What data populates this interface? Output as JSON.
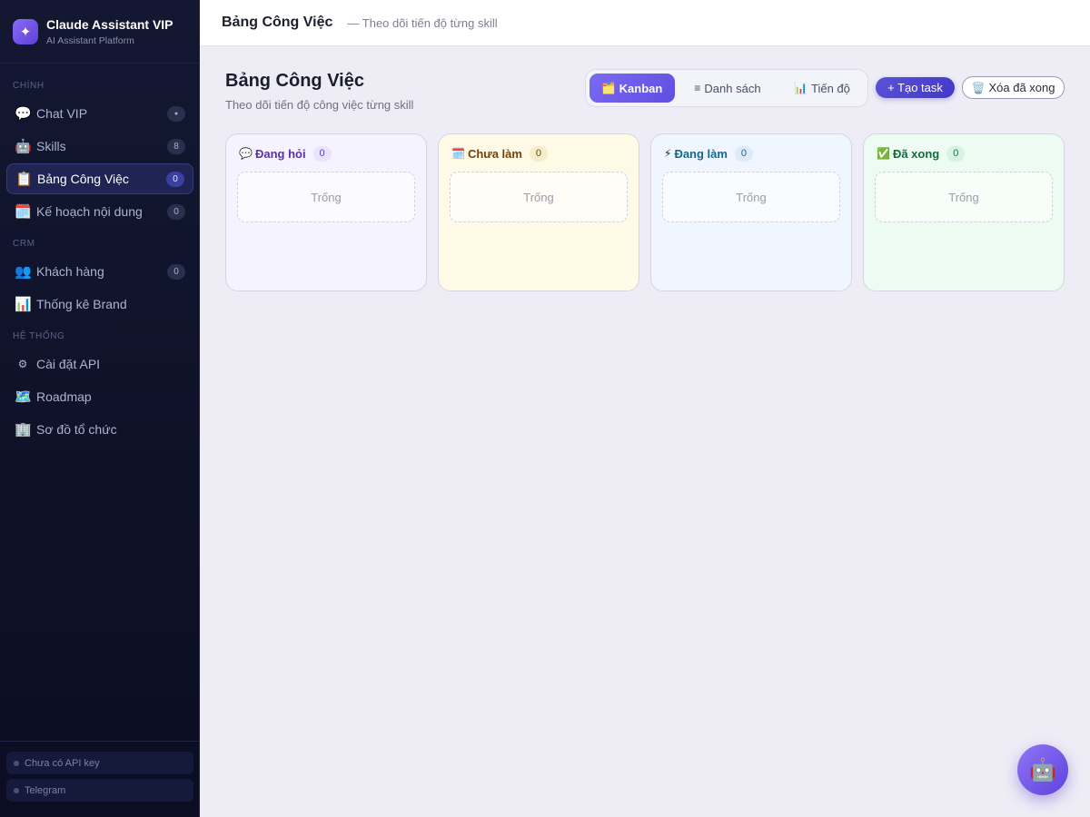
{
  "brand": {
    "title": "Claude Assistant VIP",
    "subtitle": "AI Assistant Platform",
    "logo_icon": "sparkle-icon",
    "logo_glyph": "✦"
  },
  "sidebar": {
    "sections": [
      {
        "label": "CHÍNH"
      },
      {
        "label": "CRM"
      },
      {
        "label": "HỆ THỐNG"
      }
    ],
    "items": [
      {
        "label": "Chat VIP",
        "icon": "speech-bubble-icon",
        "glyph": "💬",
        "badge": "●"
      },
      {
        "label": "Skills",
        "icon": "robot-icon",
        "glyph": "🤖",
        "badge": "8"
      },
      {
        "label": "Bảng Công Việc",
        "icon": "clipboard-icon",
        "glyph": "📋",
        "badge": "0",
        "active": true
      },
      {
        "label": "Kế hoạch nội dung",
        "icon": "calendar-icon",
        "glyph": "🗓️",
        "badge": "0"
      },
      {
        "label": "Khách hàng",
        "icon": "people-icon",
        "glyph": "👥",
        "badge": "0"
      },
      {
        "label": "Thống kê Brand",
        "icon": "bar-chart-icon",
        "glyph": "📊",
        "badge": ""
      },
      {
        "label": "Cài đặt API",
        "icon": "gear-icon",
        "glyph": "⚙",
        "badge": ""
      },
      {
        "label": "Roadmap",
        "icon": "map-icon",
        "glyph": "🗺️",
        "badge": ""
      },
      {
        "label": "Sơ đồ tổ chức",
        "icon": "building-icon",
        "glyph": "🏢",
        "badge": ""
      }
    ],
    "footer": [
      {
        "label": "Chưa có API key"
      },
      {
        "label": "Telegram"
      }
    ]
  },
  "header": {
    "title": "Bảng Công Việc",
    "subtitle": "— Theo dõi tiến độ từng skill"
  },
  "main": {
    "title": "Bảng Công Việc",
    "subtitle": "Theo dõi tiến độ công việc từng skill",
    "views": [
      {
        "label": "Kanban",
        "icon": "folder-icon",
        "glyph": "🗂️",
        "active": true
      },
      {
        "label": "Danh sách",
        "icon": "list-icon",
        "glyph": "≡"
      },
      {
        "label": "Tiến độ",
        "icon": "bar-chart-icon",
        "glyph": "📊"
      }
    ],
    "create_label": "+ Tạo task",
    "clear_label": "Xóa đã xong",
    "clear_glyph": "🗑️",
    "columns": [
      {
        "title": "Đang hỏi",
        "icon": "speech-bubble-icon",
        "glyph": "💬",
        "count": "0",
        "empty": "Trống",
        "bg": "#f5f3ff",
        "title_color": "#5b2fb0",
        "count_bg": "#e9e4fb",
        "count_color": "#5b3fb8"
      },
      {
        "title": "Chưa làm",
        "icon": "calendar-icon",
        "glyph": "🗓️",
        "count": "0",
        "empty": "Trống",
        "bg": "#fefae6",
        "title_color": "#7a3e08",
        "count_bg": "#f6ecc8",
        "count_color": "#6b4a10"
      },
      {
        "title": "Đang làm",
        "icon": "lightning-icon",
        "glyph": "⚡",
        "count": "0",
        "empty": "Trống",
        "bg": "#eff6ff",
        "title_color": "#11698f",
        "count_bg": "#dcebf7",
        "count_color": "#2b5f80"
      },
      {
        "title": "Đã xong",
        "icon": "check-mark-icon",
        "glyph": "✅",
        "count": "0",
        "empty": "Trống",
        "bg": "#ecfcf2",
        "title_color": "#126b3b",
        "count_bg": "#d6f2e1",
        "count_color": "#2a6e48"
      }
    ]
  },
  "fab": {
    "icon": "robot-icon",
    "glyph": "🤖"
  }
}
